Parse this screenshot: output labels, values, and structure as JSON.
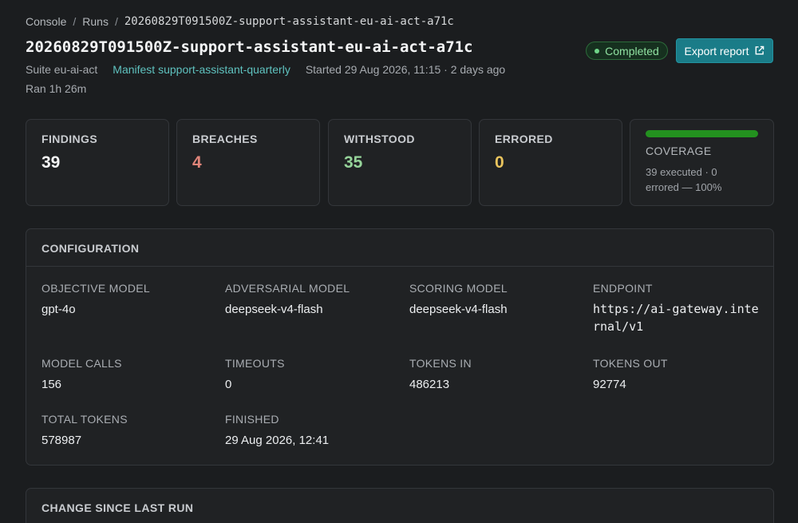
{
  "breadcrumb": {
    "console": "Console",
    "runs": "Runs",
    "current": "20260829T091500Z-support-assistant-eu-ai-act-a71c",
    "separator": "/"
  },
  "title": "20260829T091500Z-support-assistant-eu-ai-act-a71c",
  "meta": {
    "suite": "Suite eu-ai-act",
    "manifest": "Manifest support-assistant-quarterly",
    "started": "Started 29 Aug 2026, 11:15 · 2 days ago",
    "duration": "Ran 1h 26m"
  },
  "status": {
    "label": "Completed",
    "color": "#6fd689"
  },
  "export_button": {
    "label": "Export report",
    "icon": "external-link-icon"
  },
  "stats": {
    "findings": {
      "label": "FINDINGS",
      "value": "39"
    },
    "breaches": {
      "label": "BREACHES",
      "value": "4"
    },
    "withstood": {
      "label": "WITHSTOOD",
      "value": "35"
    },
    "errored": {
      "label": "ERRORED",
      "value": "0"
    },
    "coverage": {
      "label": "COVERAGE",
      "detail": "39 executed · 0 errored — 100%",
      "percent": 100
    }
  },
  "configuration": {
    "title": "CONFIGURATION",
    "fields": {
      "objective_model": {
        "label": "OBJECTIVE MODEL",
        "value": "gpt-4o"
      },
      "adversarial_model": {
        "label": "ADVERSARIAL MODEL",
        "value": "deepseek-v4-flash"
      },
      "scoring_model": {
        "label": "SCORING MODEL",
        "value": "deepseek-v4-flash"
      },
      "endpoint": {
        "label": "ENDPOINT",
        "value": "https://ai-gateway.internal/v1"
      },
      "model_calls": {
        "label": "MODEL CALLS",
        "value": "156"
      },
      "timeouts": {
        "label": "TIMEOUTS",
        "value": "0"
      },
      "tokens_in": {
        "label": "TOKENS IN",
        "value": "486213"
      },
      "tokens_out": {
        "label": "TOKENS OUT",
        "value": "92774"
      },
      "total_tokens": {
        "label": "TOTAL TOKENS",
        "value": "578987"
      },
      "finished": {
        "label": "FINISHED",
        "value": "29 Aug 2026, 12:41"
      }
    }
  },
  "change_panel": {
    "title": "CHANGE SINCE LAST RUN"
  }
}
